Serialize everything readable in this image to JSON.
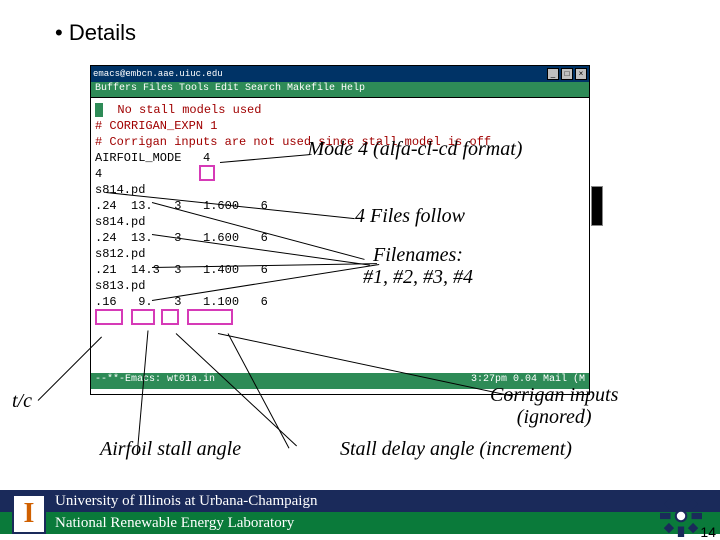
{
  "bullet": "•  Details",
  "emacs": {
    "title": "emacs@embcn.aae.uiuc.edu",
    "menubar": "Buffers Files Tools Edit Search Makefile Help",
    "win_min": "_",
    "win_max": "□",
    "win_close": "×",
    "lines": {
      "l1a": "  ",
      "l1b": "No stall models used",
      "l2": "# CORRIGAN_EXPN 1",
      "l3": "",
      "l4": "# Corrigan inputs are not used since stall model is off",
      "l5": "AIRFOIL_MODE   4",
      "l6": "4",
      "l7": "s814.pd",
      "l8": ".24  13.   3   1.600   6",
      "l9": "s814.pd",
      "l10": ".24  13.   3   1.600   6",
      "l11": "s812.pd",
      "l12": ".21  14.3  3   1.400   6",
      "l13": "s813.pd",
      "l14": ".16   9.   3   1.100   6"
    },
    "status_left": "--**-Emacs: wt01a.in",
    "status_right": "3:27pm 0.04 Mail  (M"
  },
  "annotations": {
    "mode4": "Mode 4 (alfa-cl-cd format)",
    "files_follow": "4 Files follow",
    "filenames_l1": "Filenames:",
    "filenames_l2": "#1, #2, #3, #4",
    "corrigan_l1": "Corrigan inputs",
    "corrigan_l2": "(ignored)",
    "tc": "t/c",
    "airfoil_stall": "Airfoil stall angle",
    "stall_delay": "Stall delay angle (increment)"
  },
  "footer": {
    "uiuc": "University of Illinois at Urbana-Champaign",
    "nrel": "National Renewable Energy Laboratory",
    "i_logo": "I"
  },
  "page_number": "14"
}
